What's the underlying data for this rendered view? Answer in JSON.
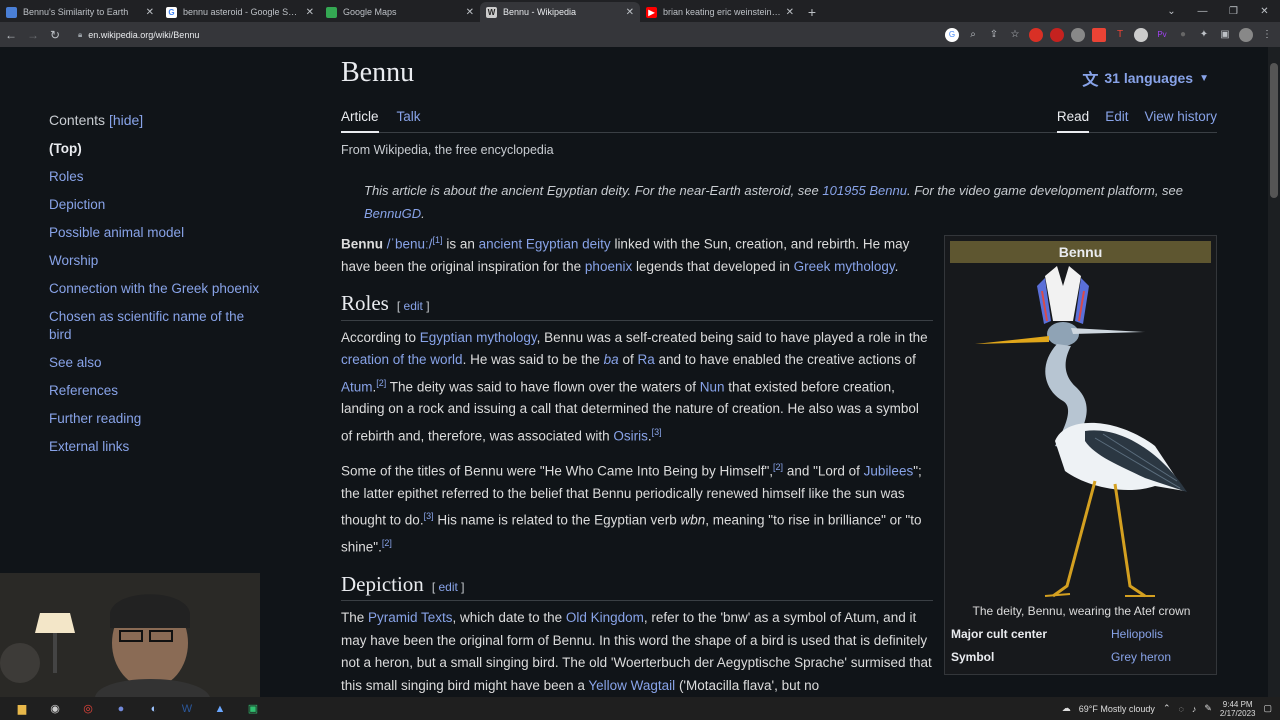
{
  "browser": {
    "tabs": [
      {
        "title": "Bennu's Similarity to Earth",
        "favicon_color": "#4a7fd6",
        "active": false
      },
      {
        "title": "bennu asteroid - Google Search",
        "favicon_color": "#ffffff",
        "active": false
      },
      {
        "title": "Google Maps",
        "favicon_color": "#34a853",
        "active": false
      },
      {
        "title": "Bennu - Wikipedia",
        "favicon_color": "#cccccc",
        "active": true
      },
      {
        "title": "brian keating eric weinstein - Yo",
        "favicon_color": "#ff0000",
        "active": false
      }
    ],
    "url": "en.wikipedia.org/wiki/Bennu"
  },
  "sidebar": {
    "contents_label": "Contents",
    "hide_label": "[hide]",
    "items": [
      "(Top)",
      "Roles",
      "Depiction",
      "Possible animal model",
      "Worship",
      "Connection with the Greek phoenix",
      "Chosen as scientific name of the bird",
      "See also",
      "References",
      "Further reading",
      "External links"
    ]
  },
  "article": {
    "title": "Bennu",
    "languages": "31 languages",
    "tabs_left": [
      "Article",
      "Talk"
    ],
    "tabs_right": [
      "Read",
      "Edit",
      "View history"
    ],
    "tagline": "From Wikipedia, the free encyclopedia",
    "hatnote": {
      "t1": "This article is about the ancient Egyptian deity. For the near-Earth asteroid, see ",
      "l1": "101955 Bennu",
      "t2": ". For the video game development platform, see ",
      "l2": "BennuGD",
      "t3": "."
    },
    "edit_label": "edit",
    "intro": {
      "bold": "Bennu",
      "ipa": "/ˈbenuː/",
      "ref1": "[1]",
      "t1": " is an ",
      "l1": "ancient Egyptian deity",
      "t2": " linked with the Sun, creation, and rebirth. He may have been the original inspiration for the ",
      "l2": "phoenix",
      "t3": " legends that developed in ",
      "l3": "Greek mythology",
      "t4": "."
    },
    "roles_heading": "Roles",
    "roles_p1": {
      "t1": "According to ",
      "l1": "Egyptian mythology",
      "t2": ", Bennu was a self-created being said to have played a role in the ",
      "l2": "creation of the world",
      "t3": ". He was said to be the ",
      "l3": "ba",
      "t4": " of ",
      "l4": "Ra",
      "t5": " and to have enabled the creative actions of ",
      "l5": "Atum",
      "r2": "[2]",
      "t6": " The deity was said to have flown over the waters of ",
      "l6": "Nun",
      "t7": " that existed before creation, landing on a rock and issuing a call that determined the nature of creation. He also was a symbol of rebirth and, therefore, was associated with ",
      "l7": "Osiris",
      "r3": "[3]"
    },
    "roles_p2": {
      "t1": "Some of the titles of Bennu were \"He Who Came Into Being by Himself\",",
      "r2": "[2]",
      "t2": " and \"Lord of ",
      "l1": "Jubilees",
      "t3": "\"; the latter epithet referred to the belief that Bennu periodically renewed himself like the sun was thought to do.",
      "r3": "[3]",
      "t4": " His name is related to the Egyptian verb ",
      "i1": "wbn",
      "t5": ", meaning \"to rise in brilliance\" or \"to shine\".",
      "r4": "[2]"
    },
    "depiction_heading": "Depiction",
    "depiction_p1": {
      "t1": "The ",
      "l1": "Pyramid Texts",
      "t2": ", which date to the ",
      "l2": "Old Kingdom",
      "t3": ", refer to the 'bnw' as a symbol of Atum, and it may have been the original form of Bennu. In this word the shape of a bird is used that is definitely not a heron, but a small singing bird. The old 'Woerterbuch der Aegyptische Sprache' surmised that this small singing bird might have been a ",
      "l3": "Yellow Wagtail",
      "t4": " ('Motacilla flava', but no"
    }
  },
  "infobox": {
    "title": "Bennu",
    "caption": "The deity, Bennu, wearing the Atef crown",
    "rows": [
      {
        "key": "Major cult center",
        "value": "Heliopolis"
      },
      {
        "key": "Symbol",
        "value": "Grey heron"
      }
    ]
  },
  "taskbar": {
    "weather": "69°F  Mostly cloudy",
    "time": "9:44 PM",
    "date": "2/17/2023"
  }
}
